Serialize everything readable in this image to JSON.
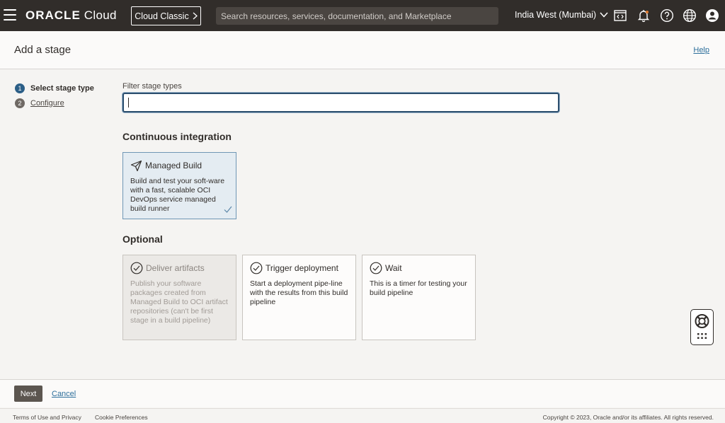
{
  "topbar": {
    "logo_bold": "ORACLE",
    "logo_rest": " Cloud",
    "cloud_classic_label": "Cloud Classic",
    "search_placeholder": "Search resources, services, documentation, and Marketplace",
    "region_label": "India West (Mumbai)"
  },
  "header": {
    "title": "Add a stage",
    "help_label": "Help"
  },
  "steps": [
    {
      "number": "1",
      "label": "Select stage type"
    },
    {
      "number": "2",
      "label": "Configure"
    }
  ],
  "filter": {
    "label": "Filter stage types",
    "value": ""
  },
  "sections": {
    "ci_title": "Continuous integration",
    "optional_title": "Optional"
  },
  "cards": {
    "managed_build": {
      "title": "Managed Build",
      "description": "Build and test your soft-ware with a fast, scalable OCI DevOps service managed build runner"
    },
    "deliver_artifacts": {
      "title": "Deliver artifacts",
      "description": "Publish your software packages created from Managed Build to OCI artifact repositories (can't be first stage in a build pipeline)"
    },
    "trigger_deployment": {
      "title": "Trigger deployment",
      "description": "Start a deployment pipe-line with the results from this build pipeline"
    },
    "wait": {
      "title": "Wait",
      "description": "This is a timer for testing your build pipeline"
    }
  },
  "actions": {
    "next_label": "Next",
    "cancel_label": "Cancel"
  },
  "footer": {
    "terms_label": "Terms of Use and Privacy",
    "cookie_label": "Cookie Preferences",
    "copyright": "Copyright © 2023, Oracle and/or its affiliates. All rights reserved."
  },
  "colors": {
    "topbar_bg": "#312d2a",
    "selected_card_bg": "#e4ecf2",
    "link": "#2c6e9b",
    "active_step": "#2c5f87"
  },
  "icons": {
    "menu": "hamburger-icon",
    "cloud_shell": "code-editor-icon",
    "notifications": "bell-icon",
    "help": "question-icon",
    "language": "globe-icon",
    "profile": "user-icon",
    "managed_build": "paper-plane-icon",
    "optional_stage": "check-circle-icon",
    "selected": "checkmark-icon",
    "help_widget": "lifebuoy-icon"
  }
}
